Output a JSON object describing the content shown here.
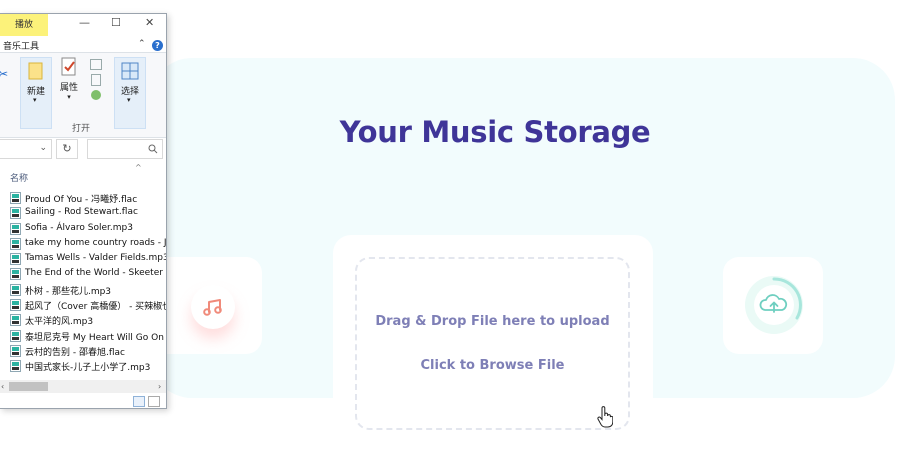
{
  "webpage": {
    "title": "Your Music Storage",
    "drop_text": "Drag & Drop File here to upload",
    "browse_text": "Click to Browse File",
    "icons": [
      "music-note-icon",
      "cloud-upload-icon",
      "hand-pointer-cursor-icon"
    ]
  },
  "explorer": {
    "tab_play": "播放",
    "tab_music_tools": "音乐工具",
    "ribbon": {
      "new_label": "新建",
      "properties_label": "属性",
      "select_label": "选择",
      "open_group_label": "打开"
    },
    "column_header_name": "名称",
    "files": [
      "Proud Of You - 冯曦妤.flac",
      "Sailing - Rod Stewart.flac",
      "Sofia - Álvaro Soler.mp3",
      "take my home country roads - Jo",
      "Tamas Wells - Valder Fields.mp3",
      "The End of the World - Skeeter D",
      "朴树 - 那些花儿.mp3",
      "起风了（Cover 高橋優） - 买辣椒也",
      "太平洋的风.mp3",
      "泰坦尼克号 My Heart Will Go On -",
      "云村的告别 - 邵春旭.flac",
      "中国式家长-儿子上小学了.mp3"
    ]
  },
  "colors": {
    "title": "#3f3598",
    "accent_text": "#7e7fb6",
    "panel_bg": "#f2fcfd",
    "music_icon": "#f08a7a",
    "cloud_icon": "#6fcfc0",
    "tab_highlight": "#fcf27a"
  }
}
